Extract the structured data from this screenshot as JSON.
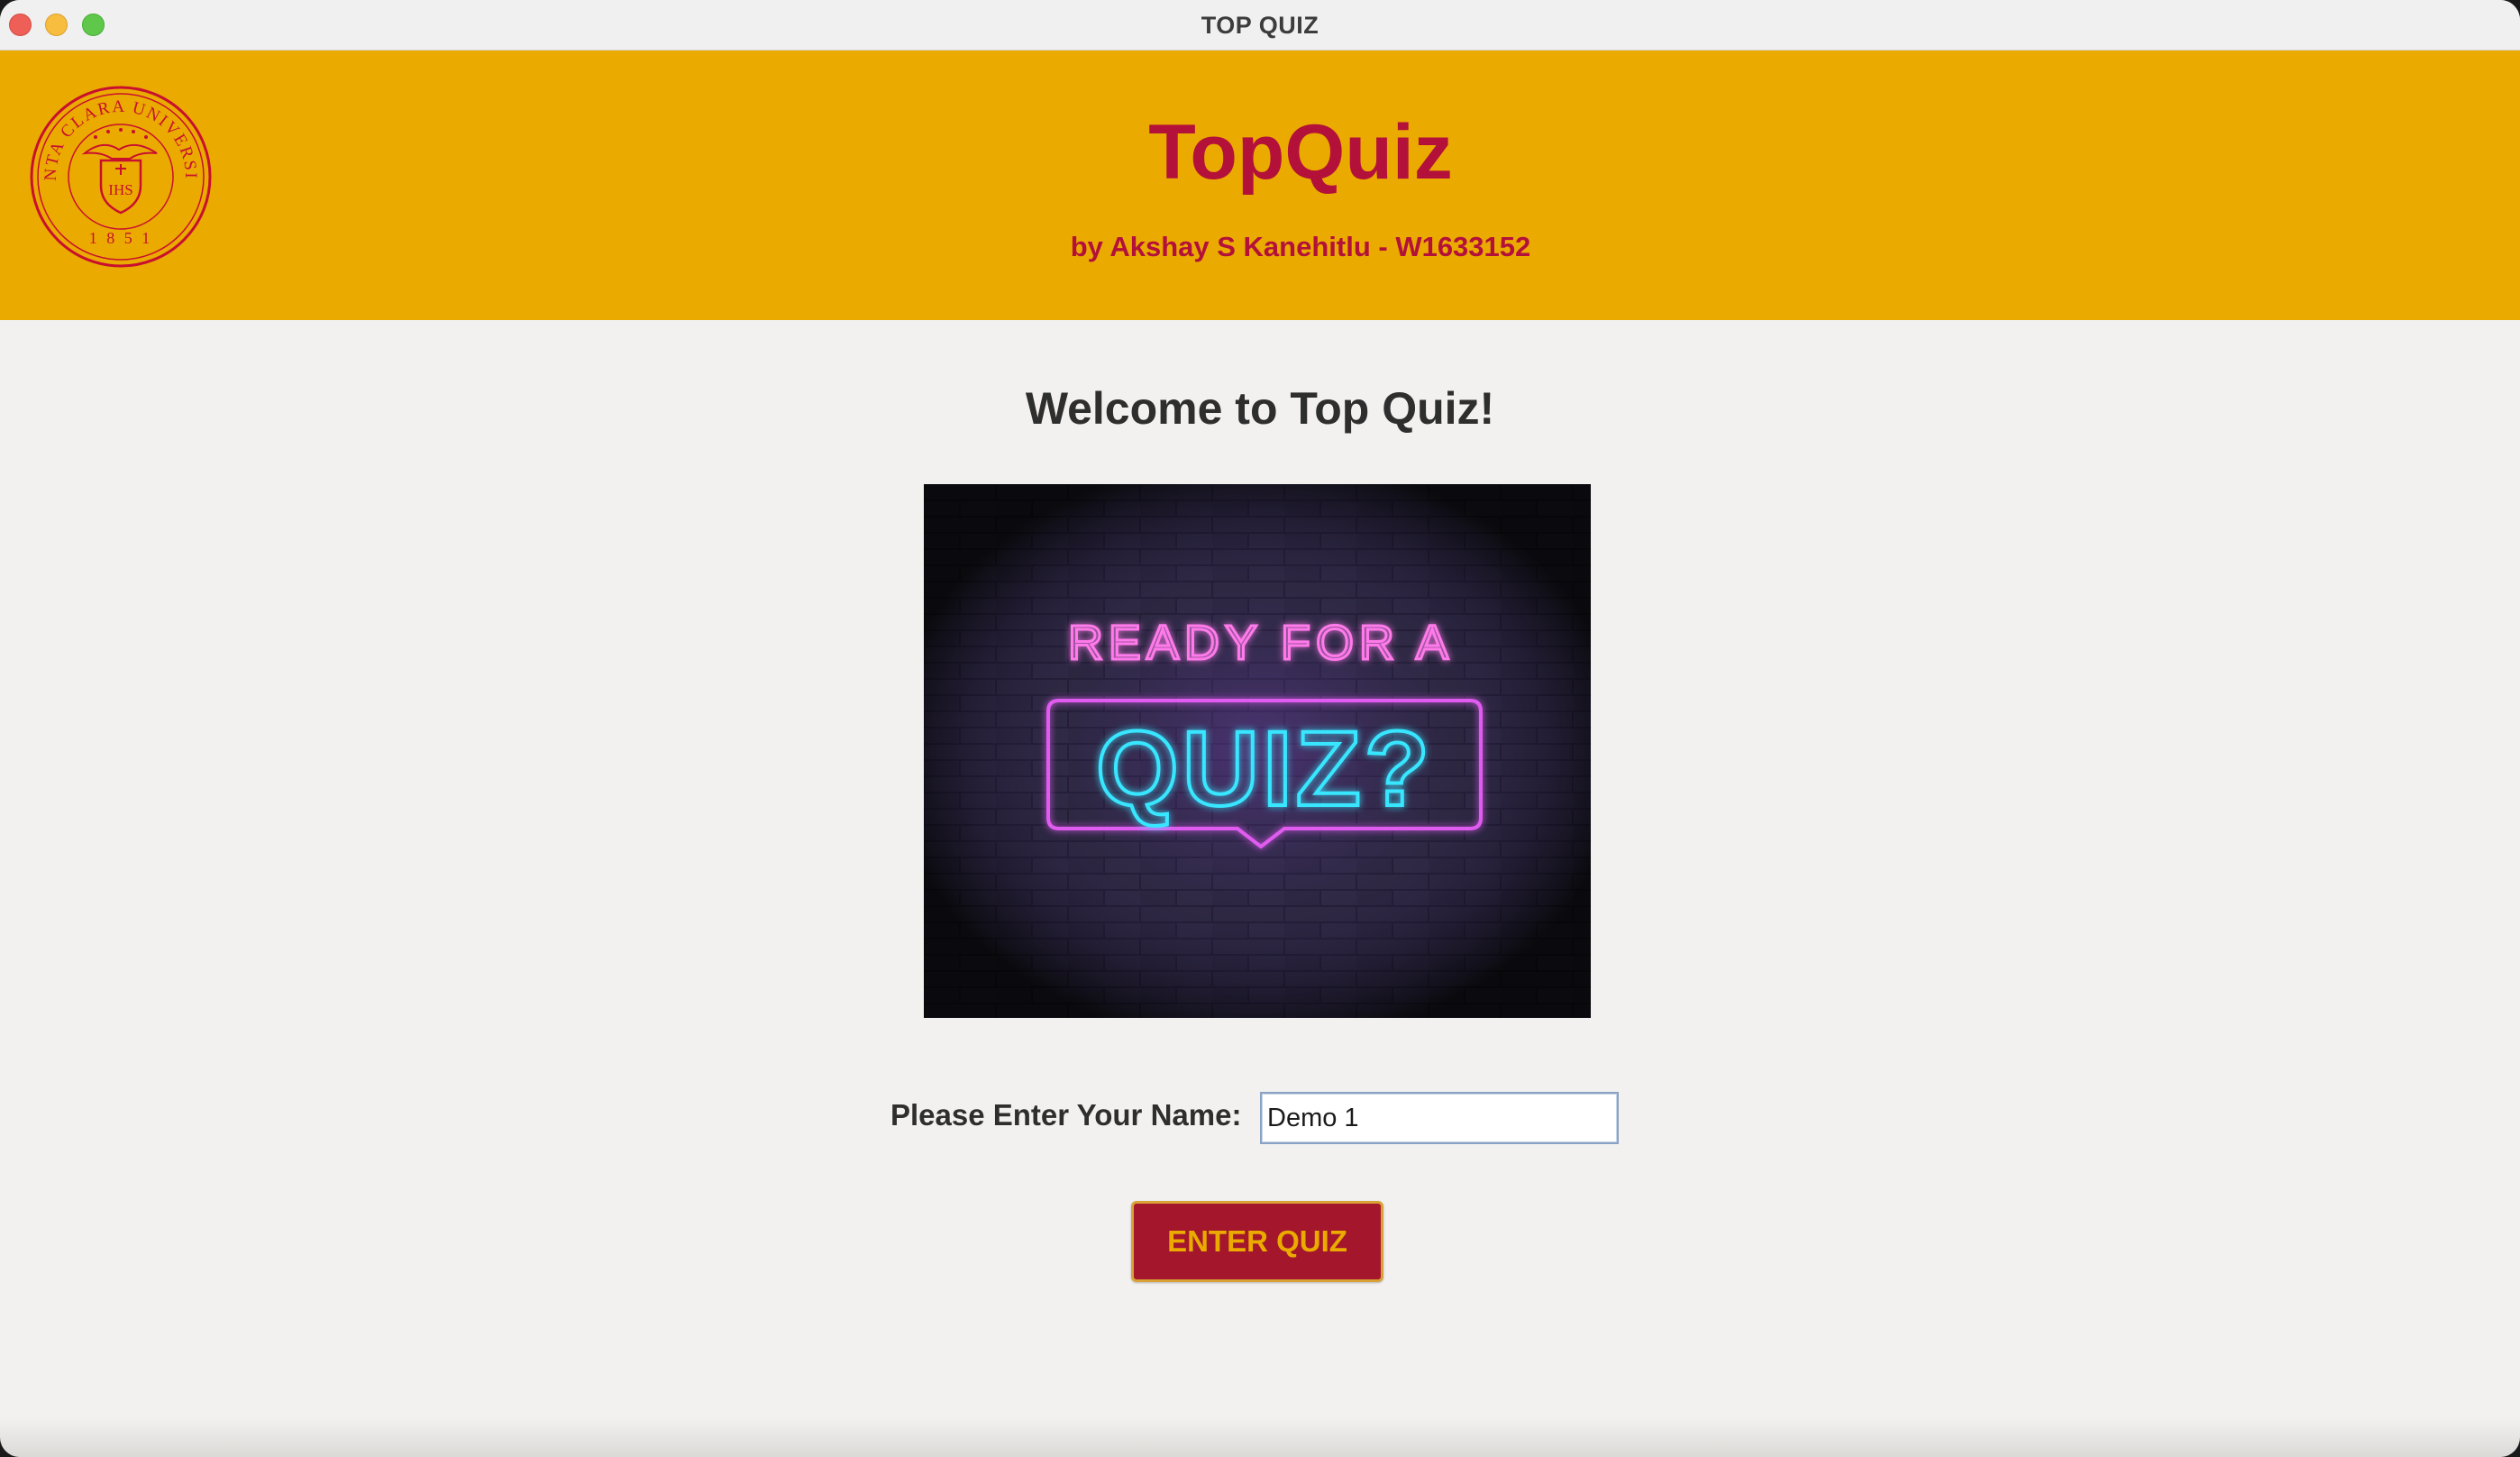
{
  "window": {
    "title": "TOP QUIZ"
  },
  "header": {
    "logo_name": "santa-clara-university-seal",
    "logo_text": "SANTA CLARA UNIVERSITY",
    "logo_year": "1 8 5 1",
    "logo_monogram": "IHS",
    "title": "TopQuiz",
    "subtitle": "by Akshay S Kanehitlu - W1633152"
  },
  "main": {
    "welcome": "Welcome to Top Quiz!",
    "image": {
      "line1": "READY FOR A",
      "line2": "QUIZ?"
    },
    "name_label": "Please Enter Your Name:",
    "name_value": "Demo 1",
    "enter_button": "ENTER QUIZ"
  },
  "colors": {
    "gold": "#eaaa00",
    "cardinal": "#b3103a",
    "button_bg": "#a3162b",
    "neon_pink": "#ff5fe3",
    "neon_cyan": "#38e6ff"
  }
}
